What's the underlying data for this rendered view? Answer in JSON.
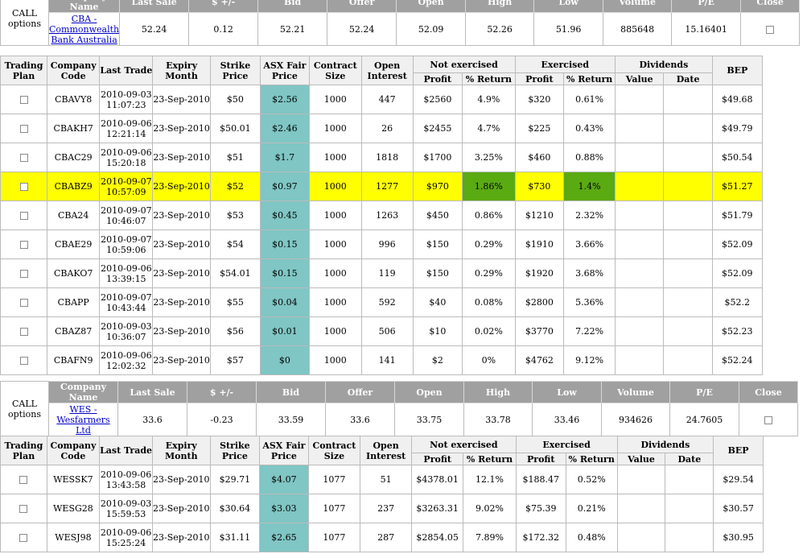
{
  "companies": [
    {
      "header": {
        "side_label": "CALL options",
        "col_company": "Company Name",
        "col_last_sale": "Last Sale",
        "col_change": "$ +/-",
        "col_bid": "Bid",
        "col_offer": "Offer",
        "col_open": "Open",
        "col_high": "High",
        "col_low": "Low",
        "col_volume": "Volume",
        "col_pe": "P/E",
        "col_close": "Close"
      },
      "quote": {
        "name": "CBA - Commonwealth Bank Australia",
        "last_sale": "52.24",
        "change": "0.12",
        "bid": "52.21",
        "offer": "52.24",
        "open": "52.09",
        "high": "52.26",
        "low": "51.96",
        "volume": "885648",
        "pe": "15.16401"
      },
      "options_header": {
        "trading_plan": "Trading Plan",
        "company_code": "Company Code",
        "last_trade": "Last Trade",
        "expiry_month": "Expiry Month",
        "strike_price": "Strike Price",
        "asx_fair_price": "ASX Fair Price",
        "contract_size": "Contract Size",
        "open_interest": "Open Interest",
        "not_exercised": "Not exercised",
        "exercised": "Exercised",
        "dividends": "Dividends",
        "bep": "BEP",
        "profit": "Profit",
        "return": "% Return",
        "value": "Value",
        "date": "Date"
      },
      "options": [
        {
          "code": "CBAVY8",
          "trade_date": "2010-09-03",
          "trade_time": "11:07:23",
          "expiry": "23-Sep-2010",
          "strike": "$50",
          "fair": "$2.56",
          "contract": "1000",
          "interest": "447",
          "ne_profit": "$2560",
          "ne_return": "4.9%",
          "ex_profit": "$320",
          "ex_return": "0.61%",
          "div_value": "",
          "div_date": "",
          "bep": "$49.68"
        },
        {
          "code": "CBAKH7",
          "trade_date": "2010-09-06",
          "trade_time": "12:21:14",
          "expiry": "23-Sep-2010",
          "strike": "$50.01",
          "fair": "$2.46",
          "contract": "1000",
          "interest": "26",
          "ne_profit": "$2455",
          "ne_return": "4.7%",
          "ex_profit": "$225",
          "ex_return": "0.43%",
          "div_value": "",
          "div_date": "",
          "bep": "$49.79"
        },
        {
          "code": "CBAC29",
          "trade_date": "2010-09-06",
          "trade_time": "15:20:18",
          "expiry": "23-Sep-2010",
          "strike": "$51",
          "fair": "$1.7",
          "contract": "1000",
          "interest": "1818",
          "ne_profit": "$1700",
          "ne_return": "3.25%",
          "ex_profit": "$460",
          "ex_return": "0.88%",
          "div_value": "",
          "div_date": "",
          "bep": "$50.54"
        },
        {
          "code": "CBABZ9",
          "trade_date": "2010-09-07",
          "trade_time": "10:57:09",
          "expiry": "23-Sep-2010",
          "strike": "$52",
          "fair": "$0.97",
          "contract": "1000",
          "interest": "1277",
          "ne_profit": "$970",
          "ne_return": "1.86%",
          "ex_profit": "$730",
          "ex_return": "1.4%",
          "div_value": "",
          "div_date": "",
          "bep": "$51.27",
          "highlight": true
        },
        {
          "code": "CBA24",
          "trade_date": "2010-09-07",
          "trade_time": "10:46:07",
          "expiry": "23-Sep-2010",
          "strike": "$53",
          "fair": "$0.45",
          "contract": "1000",
          "interest": "1263",
          "ne_profit": "$450",
          "ne_return": "0.86%",
          "ex_profit": "$1210",
          "ex_return": "2.32%",
          "div_value": "",
          "div_date": "",
          "bep": "$51.79"
        },
        {
          "code": "CBAE29",
          "trade_date": "2010-09-07",
          "trade_time": "10:59:06",
          "expiry": "23-Sep-2010",
          "strike": "$54",
          "fair": "$0.15",
          "contract": "1000",
          "interest": "996",
          "ne_profit": "$150",
          "ne_return": "0.29%",
          "ex_profit": "$1910",
          "ex_return": "3.66%",
          "div_value": "",
          "div_date": "",
          "bep": "$52.09"
        },
        {
          "code": "CBAKO7",
          "trade_date": "2010-09-06",
          "trade_time": "13:39:15",
          "expiry": "23-Sep-2010",
          "strike": "$54.01",
          "fair": "$0.15",
          "contract": "1000",
          "interest": "119",
          "ne_profit": "$150",
          "ne_return": "0.29%",
          "ex_profit": "$1920",
          "ex_return": "3.68%",
          "div_value": "",
          "div_date": "",
          "bep": "$52.09"
        },
        {
          "code": "CBAPP",
          "trade_date": "2010-09-07",
          "trade_time": "10:43:44",
          "expiry": "23-Sep-2010",
          "strike": "$55",
          "fair": "$0.04",
          "contract": "1000",
          "interest": "592",
          "ne_profit": "$40",
          "ne_return": "0.08%",
          "ex_profit": "$2800",
          "ex_return": "5.36%",
          "div_value": "",
          "div_date": "",
          "bep": "$52.2"
        },
        {
          "code": "CBAZ87",
          "trade_date": "2010-09-03",
          "trade_time": "10:36:07",
          "expiry": "23-Sep-2010",
          "strike": "$56",
          "fair": "$0.01",
          "contract": "1000",
          "interest": "506",
          "ne_profit": "$10",
          "ne_return": "0.02%",
          "ex_profit": "$3770",
          "ex_return": "7.22%",
          "div_value": "",
          "div_date": "",
          "bep": "$52.23"
        },
        {
          "code": "CBAFN9",
          "trade_date": "2010-09-06",
          "trade_time": "12:02:32",
          "expiry": "23-Sep-2010",
          "strike": "$57",
          "fair": "$0",
          "contract": "1000",
          "interest": "141",
          "ne_profit": "$2",
          "ne_return": "0%",
          "ex_profit": "$4762",
          "ex_return": "9.12%",
          "div_value": "",
          "div_date": "",
          "bep": "$52.24"
        }
      ]
    },
    {
      "header": {
        "side_label": "CALL options",
        "col_company": "Company Name",
        "col_last_sale": "Last Sale",
        "col_change": "$ +/-",
        "col_bid": "Bid",
        "col_offer": "Offer",
        "col_open": "Open",
        "col_high": "High",
        "col_low": "Low",
        "col_volume": "Volume",
        "col_pe": "P/E",
        "col_close": "Close"
      },
      "quote": {
        "name": "WES - Wesfarmers Ltd",
        "last_sale": "33.6",
        "change": "-0.23",
        "bid": "33.59",
        "offer": "33.6",
        "open": "33.75",
        "high": "33.78",
        "low": "33.46",
        "volume": "934626",
        "pe": "24.7605"
      },
      "options_header": {
        "trading_plan": "Trading Plan",
        "company_code": "Company Code",
        "last_trade": "Last Trade",
        "expiry_month": "Expiry Month",
        "strike_price": "Strike Price",
        "asx_fair_price": "ASX Fair Price",
        "contract_size": "Contract Size",
        "open_interest": "Open Interest",
        "not_exercised": "Not exercised",
        "exercised": "Exercised",
        "dividends": "Dividends",
        "bep": "BEP",
        "profit": "Profit",
        "return": "% Return",
        "value": "Value",
        "date": "Date"
      },
      "options": [
        {
          "code": "WESSK7",
          "trade_date": "2010-09-06",
          "trade_time": "13:43:58",
          "expiry": "23-Sep-2010",
          "strike": "$29.71",
          "fair": "$4.07",
          "contract": "1077",
          "interest": "51",
          "ne_profit": "$4378.01",
          "ne_return": "12.1%",
          "ex_profit": "$188.47",
          "ex_return": "0.52%",
          "div_value": "",
          "div_date": "",
          "bep": "$29.54"
        },
        {
          "code": "WESG28",
          "trade_date": "2010-09-03",
          "trade_time": "15:59:53",
          "expiry": "23-Sep-2010",
          "strike": "$30.64",
          "fair": "$3.03",
          "contract": "1077",
          "interest": "237",
          "ne_profit": "$3263.31",
          "ne_return": "9.02%",
          "ex_profit": "$75.39",
          "ex_return": "0.21%",
          "div_value": "",
          "div_date": "",
          "bep": "$30.57"
        },
        {
          "code": "WESJ98",
          "trade_date": "2010-09-06",
          "trade_time": "15:25:24",
          "expiry": "23-Sep-2010",
          "strike": "$31.11",
          "fair": "$2.65",
          "contract": "1077",
          "interest": "287",
          "ne_profit": "$2854.05",
          "ne_return": "7.89%",
          "ex_profit": "$172.32",
          "ex_return": "0.48%",
          "div_value": "",
          "div_date": "",
          "bep": "$30.95"
        }
      ]
    }
  ]
}
